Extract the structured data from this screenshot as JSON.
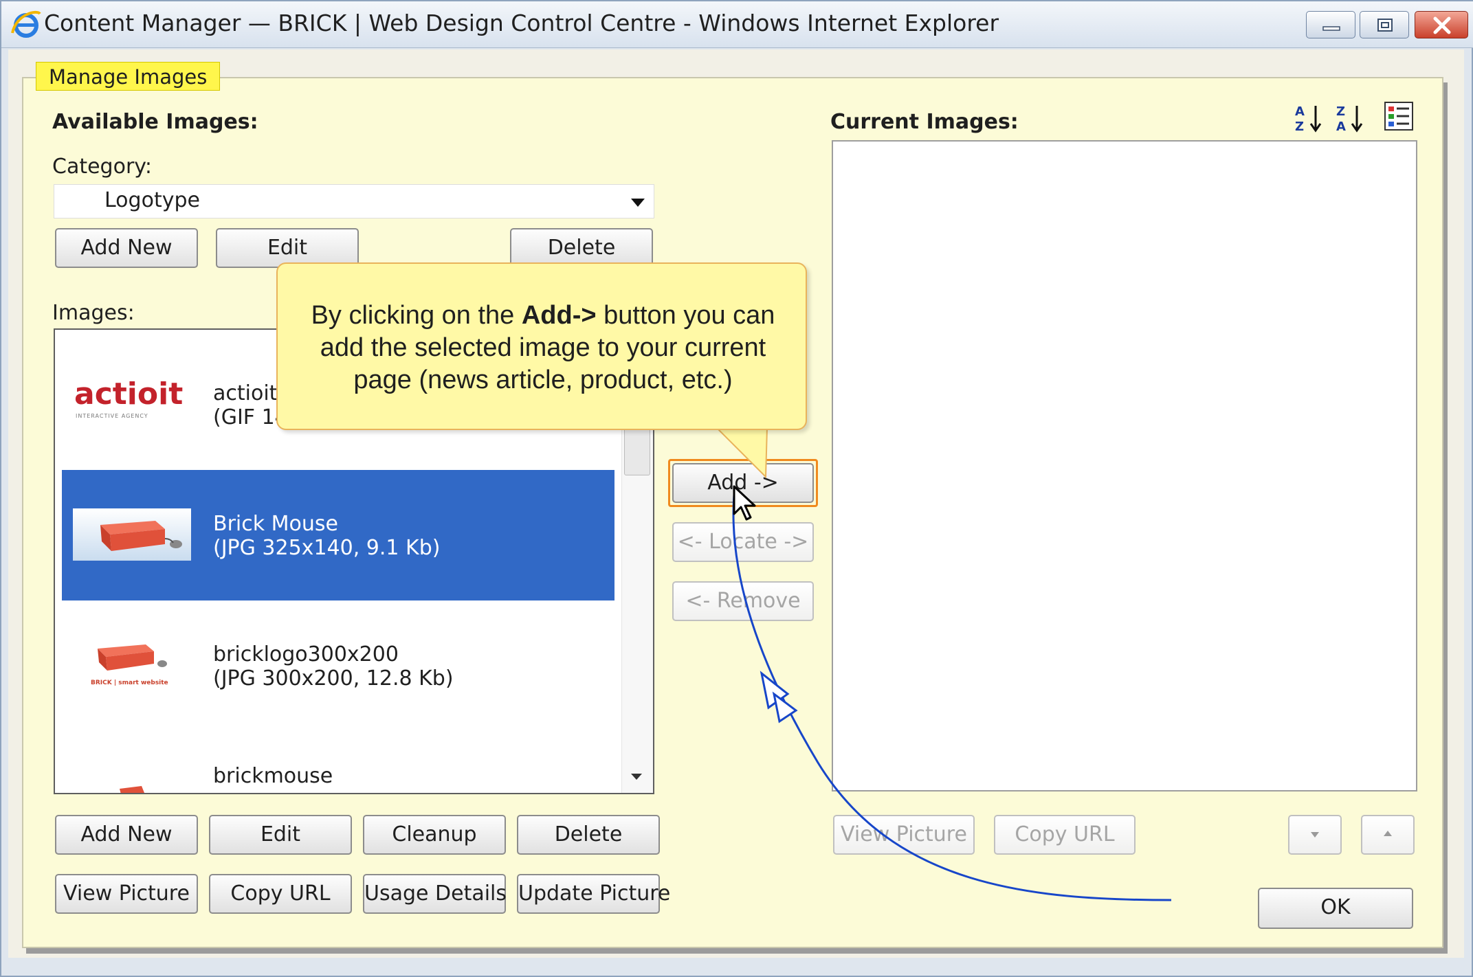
{
  "window": {
    "title": "Content Manager — BRICK | Web Design Control Centre - Windows Internet Explorer"
  },
  "tab": {
    "label": "Manage Images"
  },
  "available": {
    "heading": "Available Images:",
    "category_label": "Category:",
    "category_value": "Logotype",
    "category_buttons": {
      "add_new": "Add New",
      "edit": "Edit",
      "delete": "Delete"
    },
    "images_label": "Images:",
    "items": [
      {
        "name": "actioit s",
        "info": "(GIF 14",
        "logo_text": "actioit",
        "logo_sub": "INTERACTIVE AGENCY"
      },
      {
        "name": "Brick Mouse",
        "info": "(JPG 325x140, 9.1 Kb)",
        "selected": true
      },
      {
        "name": "bricklogo300x200",
        "info": "(JPG 300x200, 12.8 Kb)",
        "logo_sub": "BRICK | smart website"
      },
      {
        "name": "brickmouse",
        "info": ""
      }
    ],
    "bottom_buttons_row1": {
      "add_new": "Add New",
      "edit": "Edit",
      "cleanup": "Cleanup",
      "delete": "Delete"
    },
    "bottom_buttons_row2": {
      "view_picture": "View Picture",
      "copy_url": "Copy URL",
      "usage_details": "Usage Details",
      "update_picture": "Update Picture"
    }
  },
  "middle": {
    "add": "Add ->",
    "locate": "<- Locate ->",
    "remove": "<- Remove"
  },
  "current": {
    "heading": "Current Images:",
    "sort_az": "A Z",
    "sort_za": "Z A",
    "view_picture": "View Picture",
    "copy_url": "Copy URL",
    "ok": "OK"
  },
  "callout": {
    "prefix": "By clicking on the ",
    "bold": "Add->",
    "suffix": " button you can add the selected image to your current page (news article, product, etc.)"
  },
  "colors": {
    "panel_bg": "#fcfbd7",
    "tab_bg": "#fff64c",
    "selection": "#3169c6",
    "highlight": "#f08a1e",
    "callout_bg": "#fff9a6",
    "arrow": "#1746c9"
  },
  "icons": [
    "ie-icon",
    "minimize-icon",
    "maximize-icon",
    "close-icon",
    "dropdown-arrow-icon",
    "sort-az-icon",
    "sort-za-icon",
    "list-view-icon",
    "cursor-icon",
    "move-down-icon",
    "move-up-icon"
  ]
}
